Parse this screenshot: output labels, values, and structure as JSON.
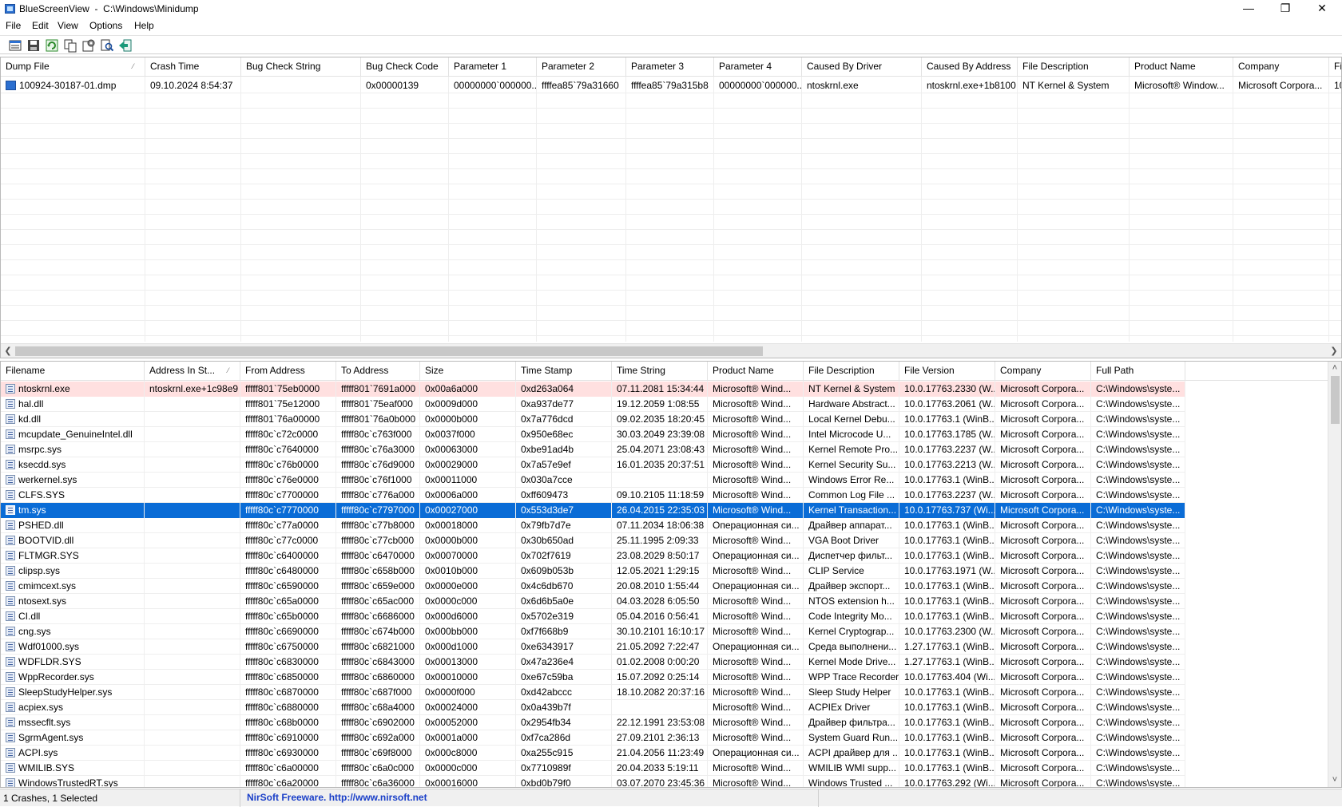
{
  "window": {
    "title": "BlueScreenView  -  C:\\Windows\\Minidump",
    "minimize": "—",
    "restore": "❐",
    "close": "✕"
  },
  "menu": [
    "File",
    "Edit",
    "View",
    "Options",
    "Help"
  ],
  "toolbar": [
    "properties-icon",
    "save-icon",
    "refresh-icon",
    "copy-icon",
    "options-icon",
    "find-icon",
    "exit-icon"
  ],
  "upper": {
    "columns": [
      "Dump File",
      "Crash Time",
      "Bug Check String",
      "Bug Check Code",
      "Parameter 1",
      "Parameter 2",
      "Parameter 3",
      "Parameter 4",
      "Caused By Driver",
      "Caused By Address",
      "File Description",
      "Product Name",
      "Company",
      "Fil"
    ],
    "sort_indicator": "⁄",
    "rows": [
      [
        "100924-30187-01.dmp",
        "09.10.2024 8:54:37",
        "",
        "0x00000139",
        "00000000`000000...",
        "ffffea85`79a31660",
        "ffffea85`79a315b8",
        "00000000`000000...",
        "ntoskrnl.exe",
        "ntoskrnl.exe+1b8100",
        "NT Kernel & System",
        "Microsoft® Window...",
        "Microsoft Corpora...",
        "10"
      ]
    ]
  },
  "lower": {
    "columns": [
      "Filename",
      "Address In St...",
      "From Address",
      "To Address",
      "Size",
      "Time Stamp",
      "Time String",
      "Product Name",
      "File Description",
      "File Version",
      "Company",
      "Full Path"
    ],
    "sort_indicator": "⁄",
    "rows": [
      [
        "ntoskrnl.exe",
        "ntoskrnl.exe+1c98e9",
        "fffff801`75eb0000",
        "fffff801`7691a000",
        "0x00a6a000",
        "0xd263a064",
        "07.11.2081 15:34:44",
        "Microsoft® Wind...",
        "NT Kernel & System",
        "10.0.17763.2330 (W...",
        "Microsoft Corpora...",
        "C:\\Windows\\syste..."
      ],
      [
        "hal.dll",
        "",
        "fffff801`75e12000",
        "fffff801`75eaf000",
        "0x0009d000",
        "0xa937de77",
        "19.12.2059 1:08:55",
        "Microsoft® Wind...",
        "Hardware Abstract...",
        "10.0.17763.2061 (W...",
        "Microsoft Corpora...",
        "C:\\Windows\\syste..."
      ],
      [
        "kd.dll",
        "",
        "fffff801`76a00000",
        "fffff801`76a0b000",
        "0x0000b000",
        "0x7a776dcd",
        "09.02.2035 18:20:45",
        "Microsoft® Wind...",
        "Local Kernel Debu...",
        "10.0.17763.1 (WinB...",
        "Microsoft Corpora...",
        "C:\\Windows\\syste..."
      ],
      [
        "mcupdate_GenuineIntel.dll",
        "",
        "fffff80c`c72c0000",
        "fffff80c`c763f000",
        "0x0037f000",
        "0x950e68ec",
        "30.03.2049 23:39:08",
        "Microsoft® Wind...",
        "Intel Microcode U...",
        "10.0.17763.1785 (W...",
        "Microsoft Corpora...",
        "C:\\Windows\\syste..."
      ],
      [
        "msrpc.sys",
        "",
        "fffff80c`c7640000",
        "fffff80c`c76a3000",
        "0x00063000",
        "0xbe91ad4b",
        "25.04.2071 23:08:43",
        "Microsoft® Wind...",
        "Kernel Remote Pro...",
        "10.0.17763.2237 (W...",
        "Microsoft Corpora...",
        "C:\\Windows\\syste..."
      ],
      [
        "ksecdd.sys",
        "",
        "fffff80c`c76b0000",
        "fffff80c`c76d9000",
        "0x00029000",
        "0x7a57e9ef",
        "16.01.2035 20:37:51",
        "Microsoft® Wind...",
        "Kernel Security Su...",
        "10.0.17763.2213 (W...",
        "Microsoft Corpora...",
        "C:\\Windows\\syste..."
      ],
      [
        "werkernel.sys",
        "",
        "fffff80c`c76e0000",
        "fffff80c`c76f1000",
        "0x00011000",
        "0x030a7cce",
        "",
        "Microsoft® Wind...",
        "Windows Error Re...",
        "10.0.17763.1 (WinB...",
        "Microsoft Corpora...",
        "C:\\Windows\\syste..."
      ],
      [
        "CLFS.SYS",
        "",
        "fffff80c`c7700000",
        "fffff80c`c776a000",
        "0x0006a000",
        "0xff609473",
        "09.10.2105 11:18:59",
        "Microsoft® Wind...",
        "Common Log File ...",
        "10.0.17763.2237 (W...",
        "Microsoft Corpora...",
        "C:\\Windows\\syste..."
      ],
      [
        "tm.sys",
        "",
        "fffff80c`c7770000",
        "fffff80c`c7797000",
        "0x00027000",
        "0x553d3de7",
        "26.04.2015 22:35:03",
        "Microsoft® Wind...",
        "Kernel Transaction...",
        "10.0.17763.737 (Wi...",
        "Microsoft Corpora...",
        "C:\\Windows\\syste..."
      ],
      [
        "PSHED.dll",
        "",
        "fffff80c`c77a0000",
        "fffff80c`c77b8000",
        "0x00018000",
        "0x79fb7d7e",
        "07.11.2034 18:06:38",
        "Операционная си...",
        "Драйвер аппарат...",
        "10.0.17763.1 (WinB...",
        "Microsoft Corpora...",
        "C:\\Windows\\syste..."
      ],
      [
        "BOOTVID.dll",
        "",
        "fffff80c`c77c0000",
        "fffff80c`c77cb000",
        "0x0000b000",
        "0x30b650ad",
        "25.11.1995 2:09:33",
        "Microsoft® Wind...",
        "VGA Boot Driver",
        "10.0.17763.1 (WinB...",
        "Microsoft Corpora...",
        "C:\\Windows\\syste..."
      ],
      [
        "FLTMGR.SYS",
        "",
        "fffff80c`c6400000",
        "fffff80c`c6470000",
        "0x00070000",
        "0x702f7619",
        "23.08.2029 8:50:17",
        "Операционная си...",
        "Диспетчер фильт...",
        "10.0.17763.1 (WinB...",
        "Microsoft Corpora...",
        "C:\\Windows\\syste..."
      ],
      [
        "clipsp.sys",
        "",
        "fffff80c`c6480000",
        "fffff80c`c658b000",
        "0x0010b000",
        "0x609b053b",
        "12.05.2021 1:29:15",
        "Microsoft® Wind...",
        "CLIP Service",
        "10.0.17763.1971 (W...",
        "Microsoft Corpora...",
        "C:\\Windows\\syste..."
      ],
      [
        "cmimcext.sys",
        "",
        "fffff80c`c6590000",
        "fffff80c`c659e000",
        "0x0000e000",
        "0x4c6db670",
        "20.08.2010 1:55:44",
        "Операционная си...",
        "Драйвер экспорт...",
        "10.0.17763.1 (WinB...",
        "Microsoft Corpora...",
        "C:\\Windows\\syste..."
      ],
      [
        "ntosext.sys",
        "",
        "fffff80c`c65a0000",
        "fffff80c`c65ac000",
        "0x0000c000",
        "0x6d6b5a0e",
        "04.03.2028 6:05:50",
        "Microsoft® Wind...",
        "NTOS extension h...",
        "10.0.17763.1 (WinB...",
        "Microsoft Corpora...",
        "C:\\Windows\\syste..."
      ],
      [
        "CI.dll",
        "",
        "fffff80c`c65b0000",
        "fffff80c`c6686000",
        "0x000d6000",
        "0x5702e319",
        "05.04.2016 0:56:41",
        "Microsoft® Wind...",
        "Code Integrity Mo...",
        "10.0.17763.1 (WinB...",
        "Microsoft Corpora...",
        "C:\\Windows\\syste..."
      ],
      [
        "cng.sys",
        "",
        "fffff80c`c6690000",
        "fffff80c`c674b000",
        "0x000bb000",
        "0xf7f668b9",
        "30.10.2101 16:10:17",
        "Microsoft® Wind...",
        "Kernel Cryptograp...",
        "10.0.17763.2300 (W...",
        "Microsoft Corpora...",
        "C:\\Windows\\syste..."
      ],
      [
        "Wdf01000.sys",
        "",
        "fffff80c`c6750000",
        "fffff80c`c6821000",
        "0x000d1000",
        "0xe6343917",
        "21.05.2092 7:22:47",
        "Операционная си...",
        "Среда выполнени...",
        "1.27.17763.1 (WinB...",
        "Microsoft Corpora...",
        "C:\\Windows\\syste..."
      ],
      [
        "WDFLDR.SYS",
        "",
        "fffff80c`c6830000",
        "fffff80c`c6843000",
        "0x00013000",
        "0x47a236e4",
        "01.02.2008 0:00:20",
        "Microsoft® Wind...",
        "Kernel Mode Drive...",
        "1.27.17763.1 (WinB...",
        "Microsoft Corpora...",
        "C:\\Windows\\syste..."
      ],
      [
        "WppRecorder.sys",
        "",
        "fffff80c`c6850000",
        "fffff80c`c6860000",
        "0x00010000",
        "0xe67c59ba",
        "15.07.2092 0:25:14",
        "Microsoft® Wind...",
        "WPP Trace Recorder",
        "10.0.17763.404 (Wi...",
        "Microsoft Corpora...",
        "C:\\Windows\\syste..."
      ],
      [
        "SleepStudyHelper.sys",
        "",
        "fffff80c`c6870000",
        "fffff80c`c687f000",
        "0x0000f000",
        "0xd42abccc",
        "18.10.2082 20:37:16",
        "Microsoft® Wind...",
        "Sleep Study Helper",
        "10.0.17763.1 (WinB...",
        "Microsoft Corpora...",
        "C:\\Windows\\syste..."
      ],
      [
        "acpiex.sys",
        "",
        "fffff80c`c6880000",
        "fffff80c`c68a4000",
        "0x00024000",
        "0x0a439b7f",
        "",
        "Microsoft® Wind...",
        "ACPIEx Driver",
        "10.0.17763.1 (WinB...",
        "Microsoft Corpora...",
        "C:\\Windows\\syste..."
      ],
      [
        "mssecflt.sys",
        "",
        "fffff80c`c68b0000",
        "fffff80c`c6902000",
        "0x00052000",
        "0x2954fb34",
        "22.12.1991 23:53:08",
        "Microsoft® Wind...",
        "Драйвер фильтра...",
        "10.0.17763.1 (WinB...",
        "Microsoft Corpora...",
        "C:\\Windows\\syste..."
      ],
      [
        "SgrmAgent.sys",
        "",
        "fffff80c`c6910000",
        "fffff80c`c692a000",
        "0x0001a000",
        "0xf7ca286d",
        "27.09.2101 2:36:13",
        "Microsoft® Wind...",
        "System Guard Run...",
        "10.0.17763.1 (WinB...",
        "Microsoft Corpora...",
        "C:\\Windows\\syste..."
      ],
      [
        "ACPI.sys",
        "",
        "fffff80c`c6930000",
        "fffff80c`c69f8000",
        "0x000c8000",
        "0xa255c915",
        "21.04.2056 11:23:49",
        "Операционная си...",
        "ACPI драйвер для ...",
        "10.0.17763.1 (WinB...",
        "Microsoft Corpora...",
        "C:\\Windows\\syste..."
      ],
      [
        "WMILIB.SYS",
        "",
        "fffff80c`c6a00000",
        "fffff80c`c6a0c000",
        "0x0000c000",
        "0x7710989f",
        "20.04.2033 5:19:11",
        "Microsoft® Wind...",
        "WMILIB WMI supp...",
        "10.0.17763.1 (WinB...",
        "Microsoft Corpora...",
        "C:\\Windows\\syste..."
      ],
      [
        "WindowsTrustedRT.sys",
        "",
        "fffff80c`c6a20000",
        "fffff80c`c6a36000",
        "0x00016000",
        "0xbd0b79f0",
        "03.07.2070 23:45:36",
        "Microsoft® Wind...",
        "Windows Trusted ...",
        "10.0.17763.292 (Wi...",
        "Microsoft Corpora...",
        "C:\\Windows\\syste..."
      ]
    ]
  },
  "status": {
    "left": "1 Crashes, 1 Selected",
    "middle": "NirSoft Freeware.  http://www.nirsoft.net"
  },
  "colors": {
    "selected": "#0a6cd6",
    "highlight": "#ffe0e0",
    "link": "#1a3fc8"
  }
}
